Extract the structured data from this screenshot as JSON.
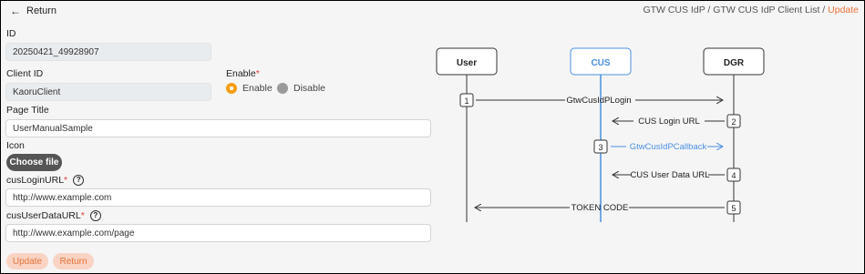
{
  "header": {
    "return_label": "Return",
    "breadcrumb": {
      "part1": "GTW CUS IdP",
      "sep1": " / ",
      "part2": "GTW CUS IdP Client List",
      "sep2": " / ",
      "current": "Update"
    }
  },
  "form": {
    "id_label": "ID",
    "id_value": "20250421_49928907",
    "client_id_label": "Client ID",
    "client_id_value": "KaoruClient",
    "enable_label": "Enable",
    "enable_required": "*",
    "enable_options": [
      {
        "label": "Enable",
        "selected": true
      },
      {
        "label": "Disable",
        "selected": false
      }
    ],
    "page_title_label": "Page Title",
    "page_title_value": "UserManualSample",
    "icon_label": "Icon",
    "choose_file_label": "Choose file",
    "cus_login_url_label": "cusLoginURL",
    "cus_login_url_required": "*",
    "cus_login_url_value": "http://www.example.com",
    "cus_user_data_url_label": "cusUserDataURL",
    "cus_user_data_url_required": "*",
    "cus_user_data_url_value": "http://www.example.com/page",
    "help_glyph": "?",
    "update_button": "Update",
    "return_button": "Return"
  },
  "diagram": {
    "actors": [
      "User",
      "CUS",
      "DGR"
    ],
    "steps": [
      {
        "num": "1",
        "label": "GtwCusIdPLogin"
      },
      {
        "num": "2",
        "label": "CUS Login URL"
      },
      {
        "num": "3",
        "label": "GtwCusIdPCallback"
      },
      {
        "num": "4",
        "label": "CUS User Data URL"
      },
      {
        "num": "5",
        "label": "TOKEN CODE"
      }
    ],
    "colors": {
      "accent": "#4a90e2",
      "line": "#333333"
    }
  },
  "colors": {
    "accent_orange": "#e8743b",
    "button_bg": "#f9d3c3",
    "radio_on": "#f39c12"
  }
}
